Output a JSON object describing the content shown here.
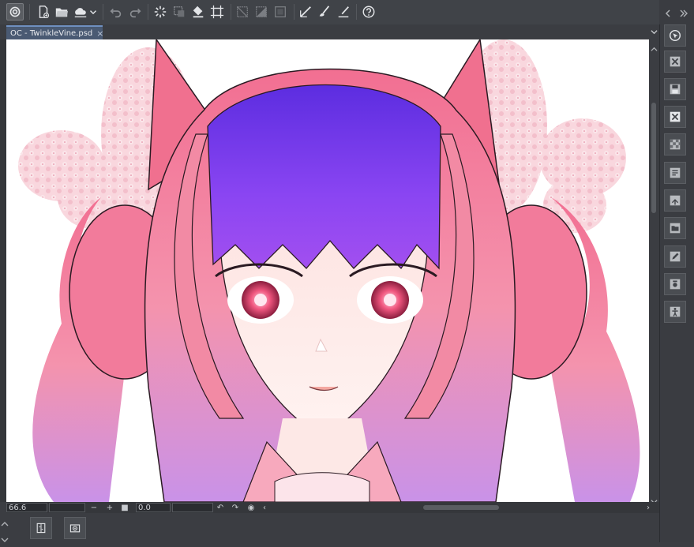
{
  "document": {
    "tab_title": "OC - TwinkleVine.psd",
    "tab_close": "×"
  },
  "status": {
    "zoom": "66.6",
    "rotation": "0.0"
  },
  "toolbar": {
    "icons": [
      "clip-studio-logo-icon",
      "new-file-icon",
      "open-folder-icon",
      "save-cloud-icon",
      "dropdown-icon",
      "undo-icon",
      "redo-icon",
      "selection-spinner-icon",
      "transform-icon",
      "fill-icon",
      "crop-icon",
      "clear-selection-icon",
      "invert-icon",
      "border-icon",
      "ruler-pen-icon",
      "brush-stroke-icon",
      "pen-tilt-icon",
      "help-icon"
    ]
  },
  "colors": {
    "chrome": "#3b3d42",
    "toolbar": "#404348",
    "tab_active": "#4a5a73",
    "canvas": "#ffffff",
    "hair_pink": "#f07a9a",
    "hair_purple": "#8a3df0",
    "flower": "#f7c9d3"
  }
}
